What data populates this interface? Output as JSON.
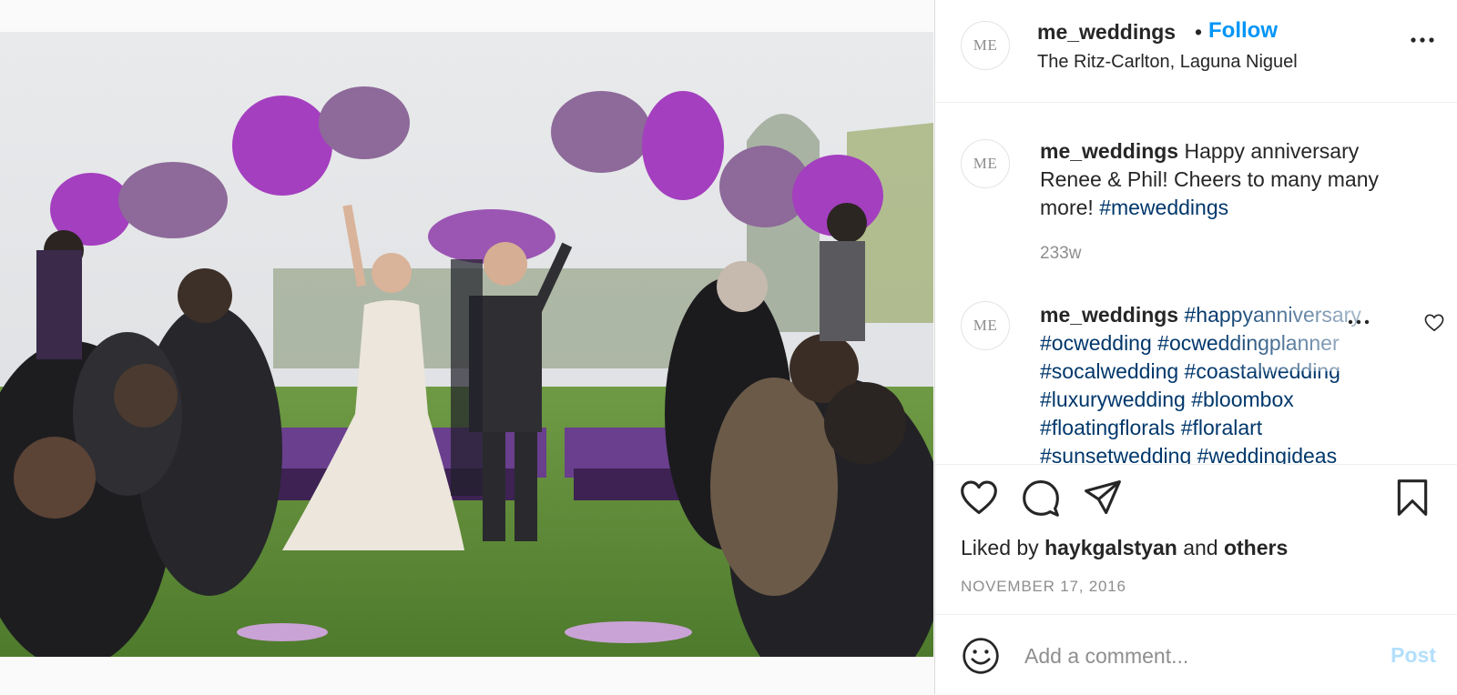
{
  "post": {
    "username": "me_weddings",
    "follow_label": "Follow",
    "separator": "•",
    "location": "The Ritz-Carlton, Laguna Niguel",
    "avatar_initials": "ME"
  },
  "caption": {
    "username": "me_weddings",
    "text": "Happy anniversary Renee & Phil! Cheers to many many more!",
    "hashtag": "#meweddings",
    "time": "233w"
  },
  "comment2": {
    "username": "me_weddings",
    "line1": "#happyanniversary",
    "line2": "#ocwedding #ocweddingplanner",
    "line3": "#socalwedding #coastalwedding",
    "line4": "#luxurywedding #bloombox",
    "line5": "#floatingflorals #floralart",
    "line6": "#sunsetwedding #weddingideas"
  },
  "likes": {
    "prefix": "Liked by",
    "user": "haykgalstyan",
    "and": "and",
    "others": "others"
  },
  "date": "NOVEMBER 17, 2016",
  "comment_input": {
    "placeholder": "Add a comment...",
    "post_label": "Post"
  },
  "icons": {
    "more": "more-horizontal-icon",
    "like": "heart-icon",
    "comment": "comment-bubble-icon",
    "share": "paper-plane-icon",
    "save": "bookmark-icon",
    "emoji": "smiley-icon"
  },
  "colors": {
    "follow": "#0095f6",
    "hashtag": "#00376b",
    "muted": "#8e8e8e",
    "post_disabled": "#b2dffc"
  }
}
